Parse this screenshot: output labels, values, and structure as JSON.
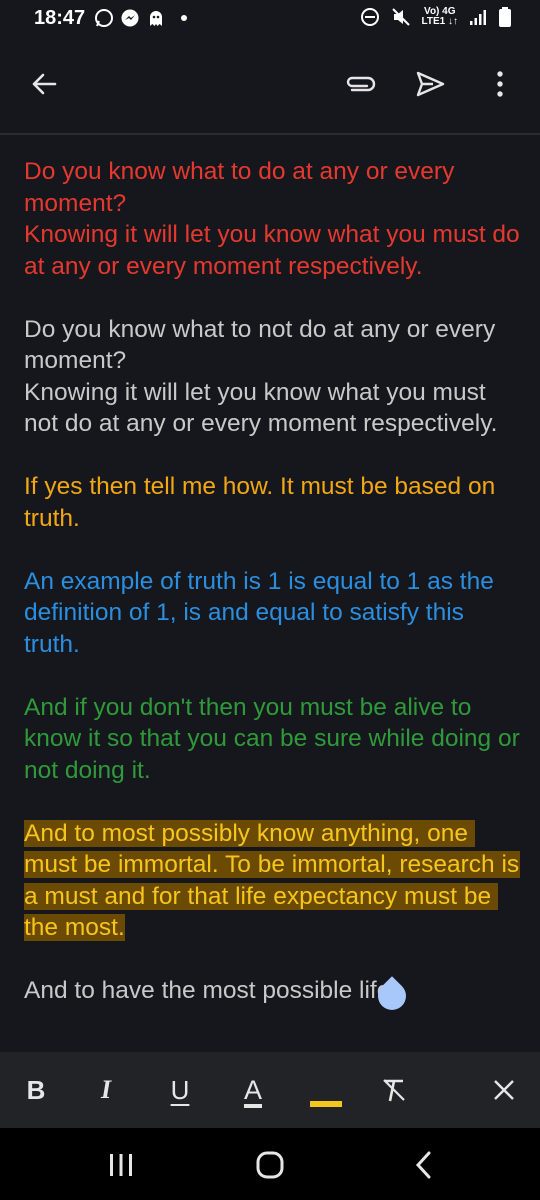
{
  "status": {
    "time": "18:47",
    "net_top": "Vo) 4G",
    "net_bottom": "LTE1 ↓↑"
  },
  "appbar": {
    "back": "back-arrow",
    "attach": "paperclip",
    "send": "send",
    "more": "more-vertical"
  },
  "paragraphs": [
    {
      "color": "red",
      "text": "Do you know what to do at any or every moment?\nKnowing it will let you know what you must do at any or every moment respectively."
    },
    {
      "color": "gray",
      "text": "Do you know what to not do at any or every moment?\nKnowing it will let you know what you must not do at any or every moment respectively."
    },
    {
      "color": "orange",
      "text": "If yes then tell me how. It must be based on truth."
    },
    {
      "color": "blue",
      "text": "An example of truth is 1 is equal to 1 as the definition of 1, is and equal to satisfy this truth."
    },
    {
      "color": "green",
      "text": "And if you don't then you must be alive to know it so that you can be sure while doing or not doing it."
    },
    {
      "color": "highlight",
      "text": "And to most possibly know anything, one must be immortal. To be immortal, research is a must and for that life expectancy must be the most."
    },
    {
      "color": "gray",
      "text": "And to have the most possible life"
    }
  ],
  "toolbar": {
    "bold": "B",
    "italic": "I",
    "underline": "U",
    "text_color": "A",
    "highlight_color": "#f7c61c"
  },
  "colors": {
    "background": "#16171c",
    "red": "#e5392f",
    "gray": "#c9c9c9",
    "orange": "#f2a713",
    "blue": "#2a8fe0",
    "green": "#2e9a3a",
    "highlight_bg": "#6b4a04",
    "highlight_fg": "#f7c61c"
  }
}
